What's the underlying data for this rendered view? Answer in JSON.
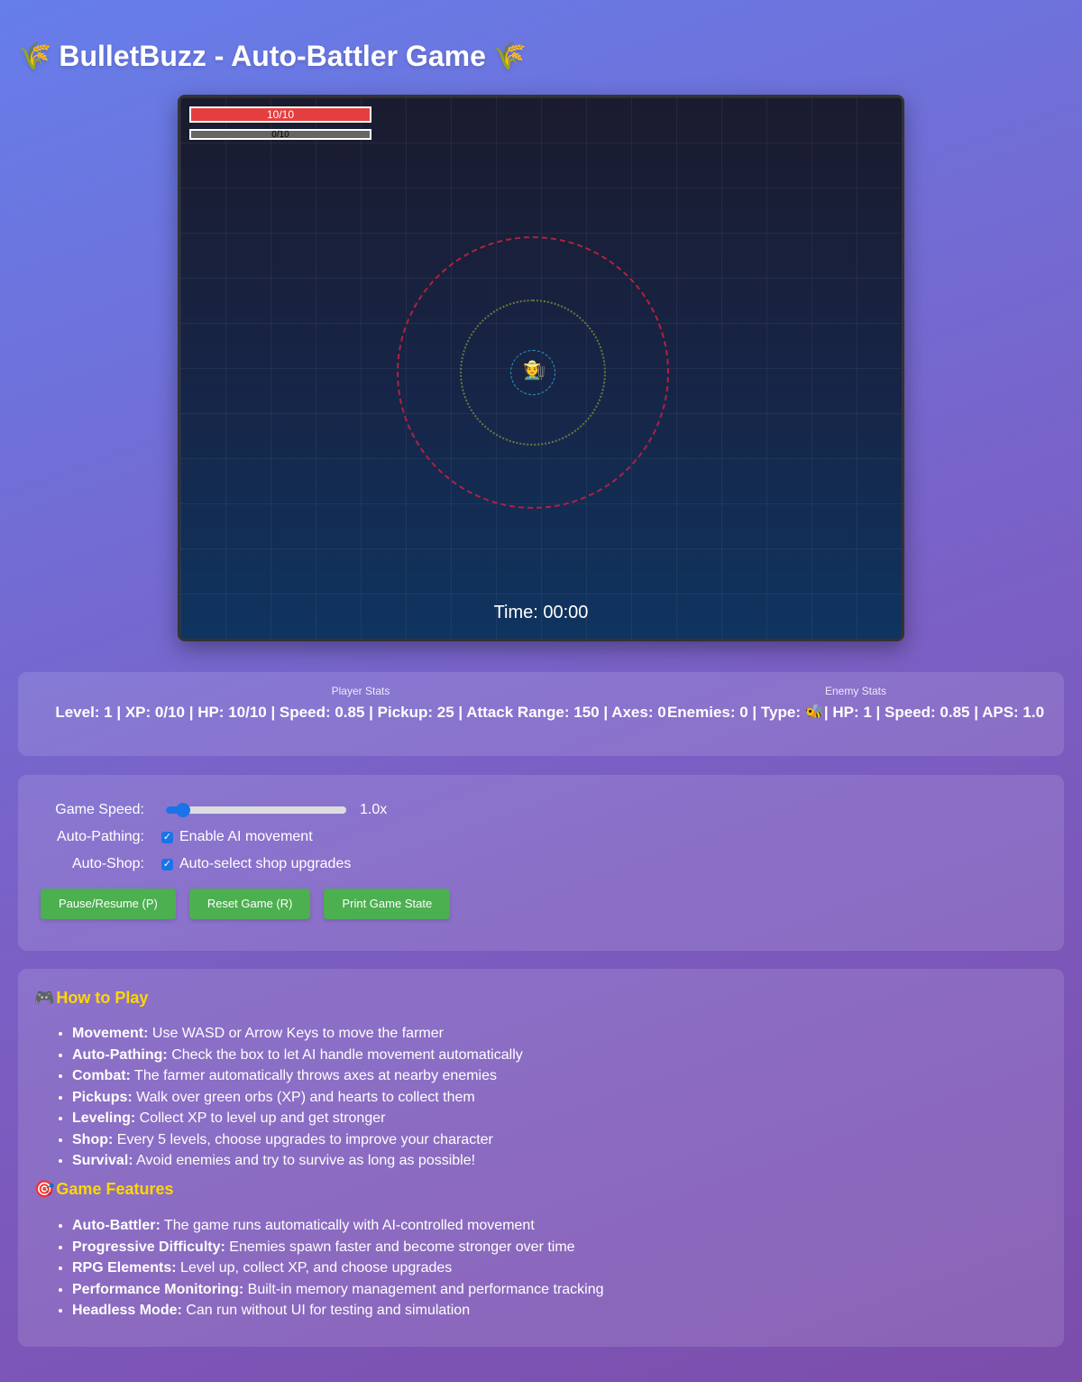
{
  "header": {
    "title": "BulletBuzz - Auto-Battler Game",
    "icon": "🌾"
  },
  "game": {
    "hp_text": "10/10",
    "xp_text": "0/10",
    "player_icon": "🧑‍🌾",
    "timer": "Time: 00:00"
  },
  "stats": {
    "player_label": "Player Stats",
    "player_value": "Level: 1 | XP: 0/10 | HP: 10/10 | Speed: 0.85 | Pickup: 25 | Attack Range: 150 | Axes: 0",
    "enemy_label": "Enemy Stats",
    "enemy_prefix": "Enemies: 0 | Type: ",
    "enemy_icon": "🐝",
    "enemy_suffix": "| HP: 1 | Speed: 0.85 | APS: 1.0"
  },
  "controls": {
    "speed_label": "Game Speed:",
    "speed_value": "1.0x",
    "speed_fraction": 0.05,
    "pathing_label": "Auto-Pathing:",
    "pathing_text": "Enable AI movement",
    "pathing_checked": true,
    "shop_label": "Auto-Shop:",
    "shop_text": "Auto-select shop upgrades",
    "shop_checked": true,
    "pause_button": "Pause/Resume (P)",
    "reset_button": "Reset Game (R)",
    "print_button": "Print Game State"
  },
  "how_to_play": {
    "icon": "🎮",
    "title": "How to Play",
    "items": [
      {
        "term": "Movement:",
        "text": " Use WASD or Arrow Keys to move the farmer"
      },
      {
        "term": "Auto-Pathing:",
        "text": " Check the box to let AI handle movement automatically"
      },
      {
        "term": "Combat:",
        "text": " The farmer automatically throws axes at nearby enemies"
      },
      {
        "term": "Pickups:",
        "text": " Walk over green orbs (XP) and hearts to collect them"
      },
      {
        "term": "Leveling:",
        "text": " Collect XP to level up and get stronger"
      },
      {
        "term": "Shop:",
        "text": " Every 5 levels, choose upgrades to improve your character"
      },
      {
        "term": "Survival:",
        "text": " Avoid enemies and try to survive as long as possible!"
      }
    ]
  },
  "features": {
    "icon": "🎯",
    "title": "Game Features",
    "items": [
      {
        "term": "Auto-Battler:",
        "text": " The game runs automatically with AI-controlled movement"
      },
      {
        "term": "Progressive Difficulty:",
        "text": " Enemies spawn faster and become stronger over time"
      },
      {
        "term": "RPG Elements:",
        "text": " Level up, collect XP, and choose upgrades"
      },
      {
        "term": "Performance Monitoring:",
        "text": " Built-in memory management and performance tracking"
      },
      {
        "term": "Headless Mode:",
        "text": " Can run without UI for testing and simulation"
      }
    ]
  },
  "colors": {
    "accent_yellow": "#ffd700",
    "button_green": "#4caf50",
    "hp_red": "#e53e3e"
  }
}
